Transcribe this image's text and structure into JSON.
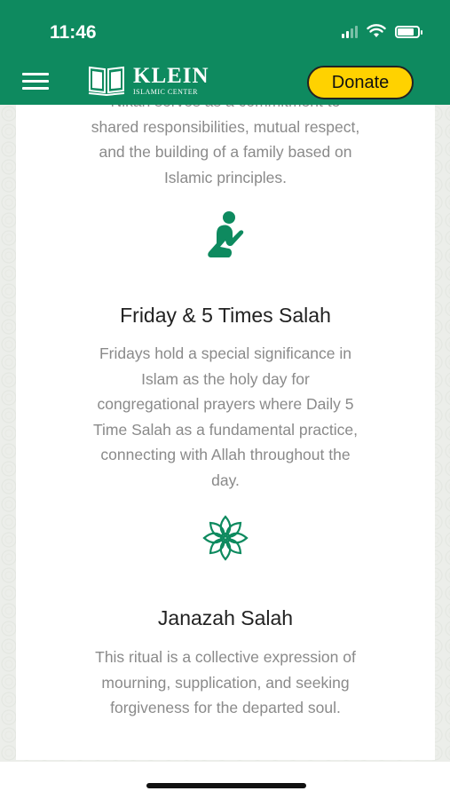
{
  "status_bar": {
    "time": "11:46"
  },
  "header": {
    "logo_main": "KLEIN",
    "logo_sub": "ISLAMIC CENTER",
    "donate_label": "Donate",
    "menu_icon": "hamburger-icon"
  },
  "colors": {
    "brand_green": "#0e8a5f",
    "donate_yellow": "#ffd200",
    "body_text": "#8a8a8a",
    "heading_text": "#222222"
  },
  "sections": {
    "nikah": {
      "cutoff_line": "Nikah serves as a commitment to",
      "lines": [
        "shared responsibilities, mutual respect,",
        "and the building of a family based on",
        "Islamic principles."
      ]
    },
    "friday": {
      "icon": "prayer-icon",
      "title": "Friday & 5 Times Salah",
      "lines": [
        "Fridays hold a special significance in",
        "Islam as the holy day for",
        "congregational prayers where Daily 5",
        "Time Salah as a fundamental practice,",
        "connecting with Allah throughout the",
        "day."
      ]
    },
    "janazah": {
      "icon": "floral-star-icon",
      "title": "Janazah Salah",
      "lines": [
        "This ritual is a collective expression of",
        "mourning, supplication, and seeking",
        "forgiveness for the departed soul."
      ]
    }
  }
}
